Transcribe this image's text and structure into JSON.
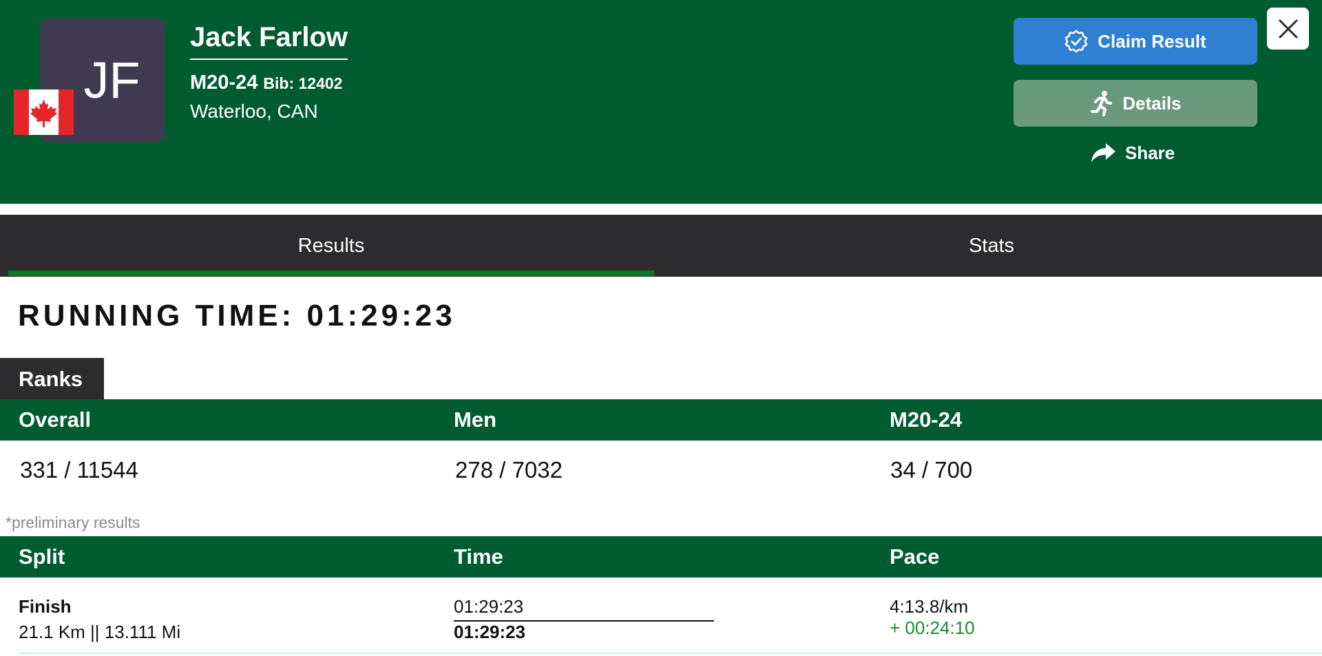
{
  "athlete": {
    "initials": "JF",
    "name": "Jack Farlow",
    "category": "M20-24",
    "bib_label": "Bib: 12402",
    "location": "Waterloo, CAN"
  },
  "actions": {
    "claim_label": "Claim Result",
    "details_label": "Details",
    "share_label": "Share"
  },
  "tabs": [
    {
      "label": "Results",
      "active": true
    },
    {
      "label": "Stats",
      "active": false
    }
  ],
  "running_time": {
    "label": "RUNNING TIME:",
    "value": "01:29:23"
  },
  "ranks": {
    "tag": "Ranks",
    "headers": [
      "Overall",
      "Men",
      "M20-24"
    ],
    "values": [
      "331 / 11544",
      "278 / 7032",
      "34 / 700"
    ],
    "note": "*preliminary results"
  },
  "splits": {
    "headers": [
      "Split",
      "Time",
      "Pace"
    ],
    "rows": [
      {
        "name": "Finish",
        "distance": "21.1 Km || 13.111 Mi",
        "time_primary": "01:29:23",
        "time_secondary": "01:29:23",
        "pace": "4:13.8/km",
        "pace_delta": "+ 00:24:10"
      }
    ]
  },
  "colors": {
    "header_green": "#005c2f",
    "tab_bar": "#2c2c2e",
    "claim_blue": "#2f7fd2",
    "details_green": "#6a9a7c",
    "active_tab_underline": "#0a7a25",
    "delta_green": "#1b8a2c"
  },
  "icons": {
    "claim": "verified-badge-icon",
    "details": "runner-icon",
    "share": "share-arrow-icon",
    "close": "close-icon",
    "flag": "canada-flag-icon"
  }
}
